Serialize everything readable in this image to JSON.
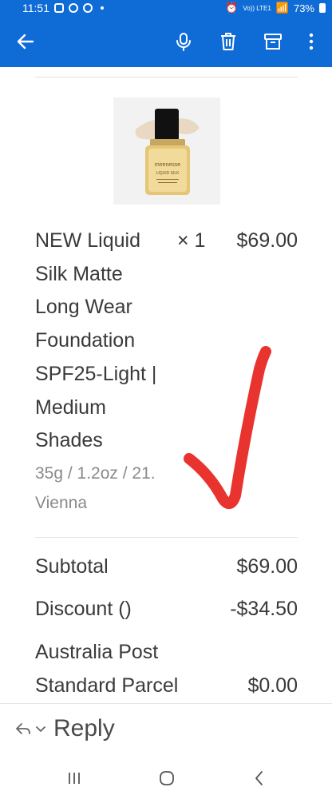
{
  "status_bar": {
    "time": "11:51",
    "network": "Vo)) LTE1",
    "battery": "73%"
  },
  "toolbar": {
    "back_icon": "arrow-left-icon",
    "mic_icon": "microphone-icon",
    "delete_icon": "trash-icon",
    "archive_icon": "archive-icon",
    "more_icon": "more-vertical-icon",
    "background_color": "#0f6cd6"
  },
  "product": {
    "image_brand": "mirenesse",
    "image_name": "LIQUID SILK",
    "name": "NEW Liquid Silk Matte Long Wear Foundation SPF25-Light | Medium Shades",
    "quantity": "× 1",
    "price": "$69.00",
    "variant": "35g / 1.2oz / 21. Vienna"
  },
  "summary": {
    "subtotal_label": "Subtotal",
    "subtotal_value": "$69.00",
    "discount_label": "Discount ()",
    "discount_value": "-$34.50",
    "shipping_label": "Australia Post Standard Parcel",
    "shipping_value": "$0.00"
  },
  "annotation": {
    "check_color": "#e8332f"
  },
  "reply_bar": {
    "reply_label": "Reply",
    "reply_icon": "reply-icon",
    "chevron_icon": "chevron-down-icon"
  },
  "nav": {
    "recents_icon": "recents-icon",
    "home_icon": "home-icon",
    "back_icon": "nav-back-icon"
  }
}
